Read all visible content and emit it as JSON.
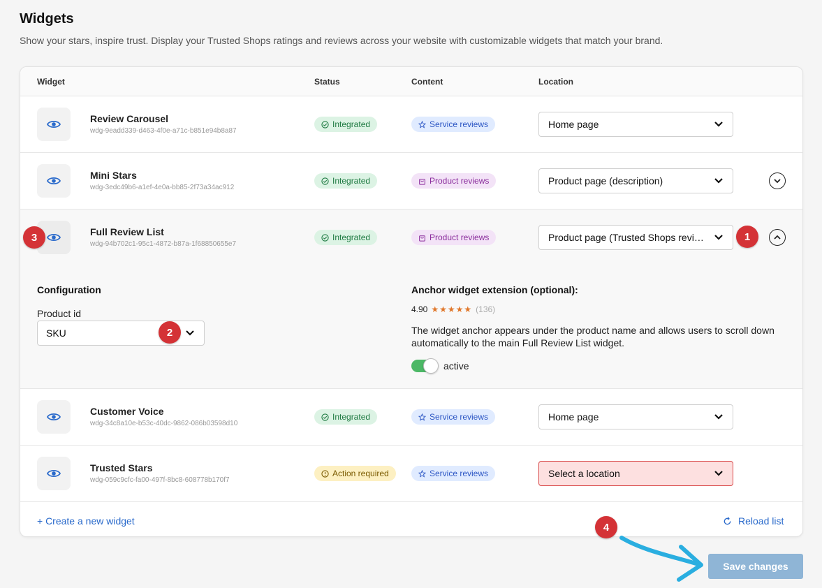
{
  "header": {
    "title": "Widgets",
    "subtitle": "Show your stars, inspire trust. Display your Trusted Shops ratings and reviews across your website with customizable widgets that match your brand."
  },
  "table": {
    "columns": [
      "Widget",
      "Status",
      "Content",
      "Location"
    ],
    "rows": [
      {
        "name": "Review Carousel",
        "id": "wdg-9eadd339-d463-4f0e-a71c-b851e94b8a87",
        "status": "Integrated",
        "content": "Service reviews",
        "location": "Home page"
      },
      {
        "name": "Mini Stars",
        "id": "wdg-3edc49b6-a1ef-4e0a-bb85-2f73a34ac912",
        "status": "Integrated",
        "content": "Product reviews",
        "location": "Product page (description)"
      },
      {
        "name": "Full Review List",
        "id": "wdg-94b702c1-95c1-4872-b87a-1f68850655e7",
        "status": "Integrated",
        "content": "Product reviews",
        "location": "Product page (Trusted Shops reviews tab)"
      },
      {
        "name": "Customer Voice",
        "id": "wdg-34c8a10e-b53c-40dc-9862-086b03598d10",
        "status": "Integrated",
        "content": "Service reviews",
        "location": "Home page"
      },
      {
        "name": "Trusted Stars",
        "id": "wdg-059c9cfc-fa00-497f-8bc8-608778b170f7",
        "status": "Action required",
        "content": "Service reviews",
        "location": "Select a location"
      }
    ]
  },
  "expanded": {
    "config_title": "Configuration",
    "product_id_label": "Product id",
    "product_id_value": "SKU",
    "anchor_title": "Anchor widget extension (optional):",
    "rating": "4.90",
    "stars": "★★★★★",
    "review_count": "(136)",
    "anchor_description": "The widget anchor appears under the product name and allows users to scroll down automatically to the main Full Review List widget.",
    "toggle_state": "on",
    "toggle_label": "active"
  },
  "footer": {
    "create_link": "+ Create a new widget",
    "reload_link": "Reload list",
    "save_button": "Save changes"
  },
  "markers": [
    "1",
    "2",
    "3",
    "4"
  ],
  "colors": {
    "accent": "#2a6acb",
    "marker": "#d43236",
    "status_ok_bg": "#dcf3e4",
    "status_warn_bg": "#fdf0c2",
    "service_bg": "#e0ebff",
    "product_bg": "#f3e3f7",
    "error_select_bg": "#fde0e0",
    "toggle_on": "#4cb866",
    "save_button_bg": "#8fb5d6",
    "annotation_arrow": "#2aaee0"
  },
  "icons": {
    "preview": "eye-icon",
    "status_ok": "check-circle-icon",
    "status_warn": "alert-circle-icon",
    "service": "star-outline-icon",
    "product": "shopping-bag-icon",
    "dropdown": "chevron-down-icon",
    "expand": "chevron-down-circle-icon",
    "collapse": "chevron-up-circle-icon",
    "reload": "refresh-icon"
  }
}
